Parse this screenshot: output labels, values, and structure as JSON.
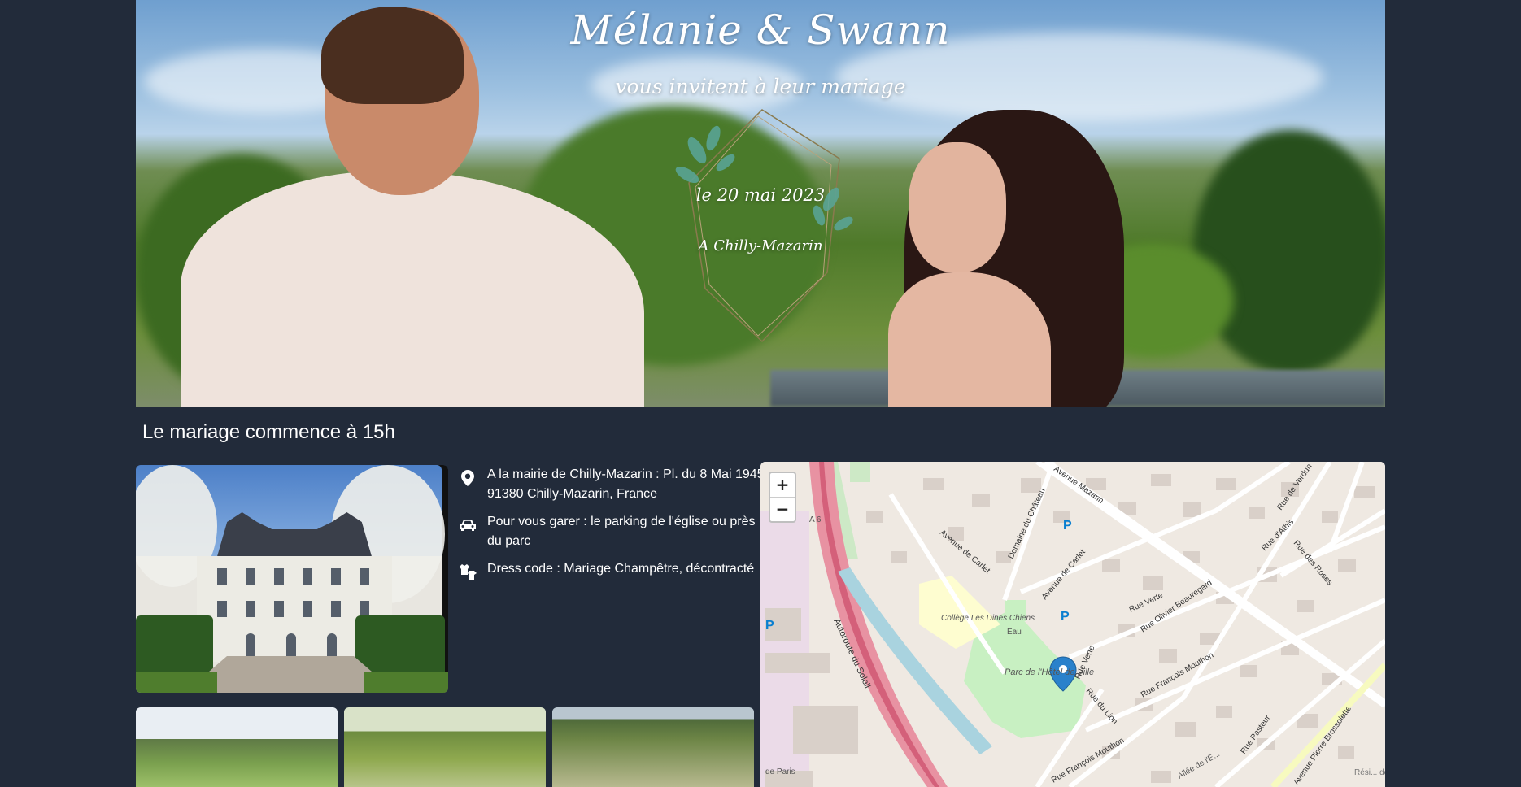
{
  "hero": {
    "title": "Mélanie & Swann",
    "subtitle": "vous invitent à leur mariage",
    "date": "le 20 mai 2023",
    "place": "A Chilly-Mazarin"
  },
  "start_heading": "Le mariage commence à 15h",
  "info": {
    "items": [
      {
        "icon": "location-pin-icon",
        "text": "A la mairie de Chilly-Mazarin : Pl. du 8 Mai 1945, 91380 Chilly-Mazarin, France"
      },
      {
        "icon": "car-icon",
        "text": "Pour vous garer : le parking de l'église ou près du parc"
      },
      {
        "icon": "clothes-icon",
        "text": "Dress code : Mariage Champêtre, décontracté"
      }
    ]
  },
  "map": {
    "zoom_in": "+",
    "zoom_out": "−",
    "labels": {
      "college": "Collège Les Dines Chiens",
      "parc": "Parc de l'Hôtel de Ville",
      "autoroute": "Autoroute du Soleil",
      "a6": "A 6",
      "mazarin": "Avenue Mazarin",
      "carlet1": "Avenue de Carlet",
      "carlet2": "Avenue de Carlet",
      "chateau": "Domaine du Château",
      "verte1": "Rue Verte",
      "verte2": "Rue Verte",
      "beauregard": "Rue Olivier Beauregard",
      "mouthon1": "Rue François Mouthon",
      "mouthon2": "Rue François Mouthon",
      "lion": "Rue du Lion",
      "athis": "Rue d'Athis",
      "roses": "Rue des Roses",
      "pasteur": "Rue Pasteur",
      "brossolette": "Avenue Pierre Brossolette",
      "verdun": "Rue de Verdun",
      "eau": "Eau",
      "paris": "de Paris",
      "allee": "Allée de l'É...",
      "resi": "Rési... de la Li..."
    }
  }
}
